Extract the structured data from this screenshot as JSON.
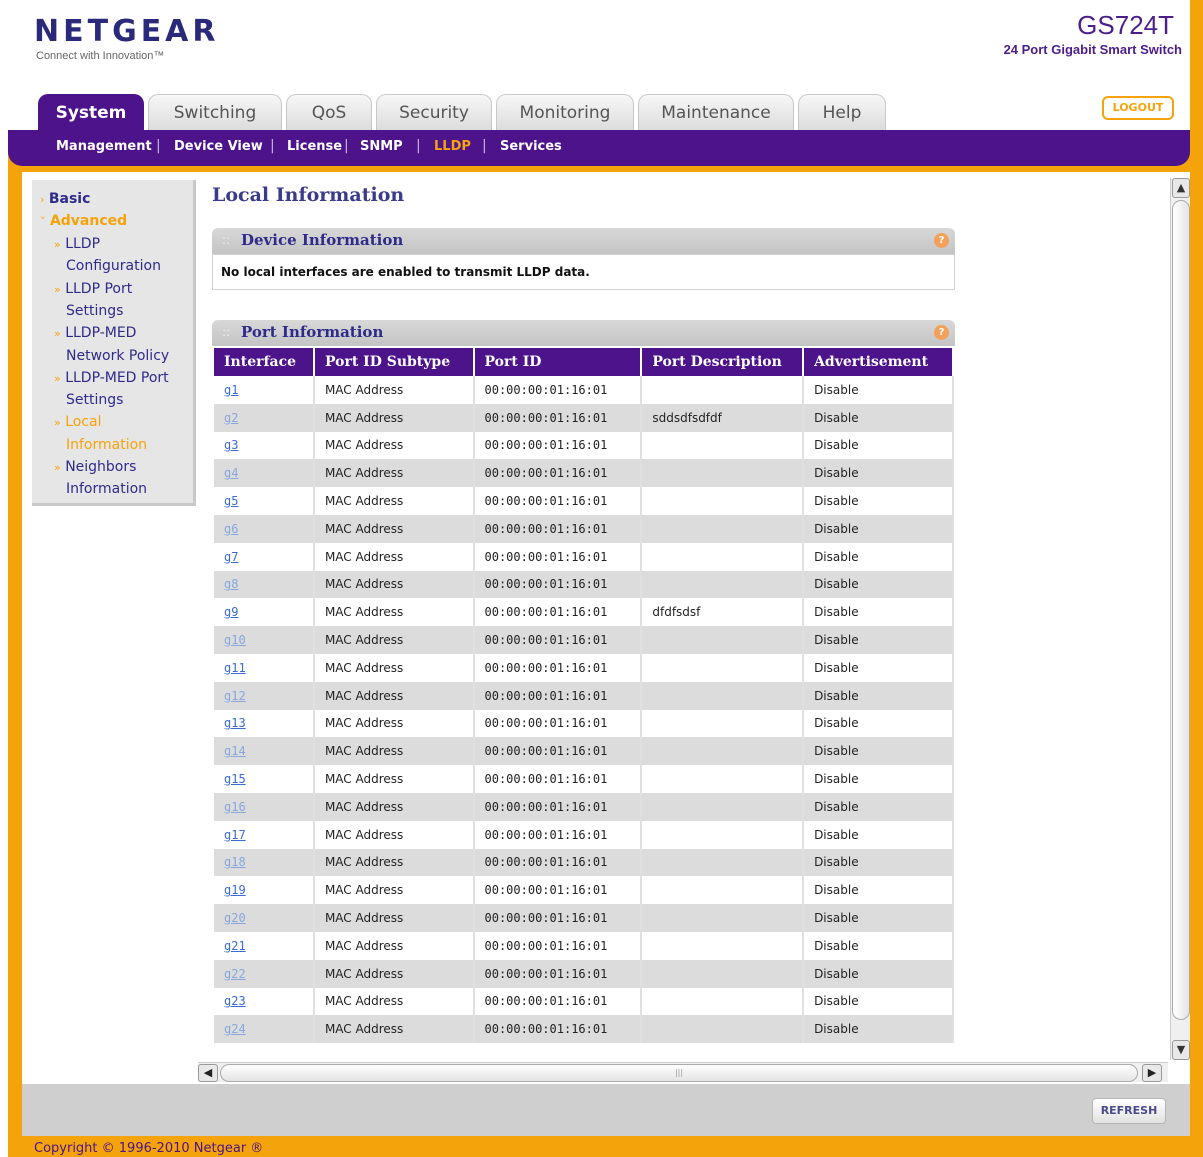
{
  "brand": {
    "logo": "NETGEAR",
    "tagline": "Connect with Innovation™",
    "model": "GS724T",
    "model_desc": "24 Port Gigabit Smart Switch"
  },
  "tabs": [
    "System",
    "Switching",
    "QoS",
    "Security",
    "Monitoring",
    "Maintenance",
    "Help"
  ],
  "logout": "LOGOUT",
  "subnav": [
    "Management",
    "Device View",
    "License",
    "SNMP",
    "LLDP",
    "Services"
  ],
  "sidebar": [
    {
      "bullet": "›",
      "label": "Basic"
    },
    {
      "bullet": "˅",
      "label": "Advanced"
    },
    {
      "bullet": "»",
      "label": "LLDP"
    },
    {
      "bullet": "",
      "label": "Configuration"
    },
    {
      "bullet": "»",
      "label": "LLDP Port"
    },
    {
      "bullet": "",
      "label": "Settings"
    },
    {
      "bullet": "»",
      "label": "LLDP-MED"
    },
    {
      "bullet": "",
      "label": "Network Policy"
    },
    {
      "bullet": "»",
      "label": "LLDP-MED Port"
    },
    {
      "bullet": "",
      "label": "Settings"
    },
    {
      "bullet": "»",
      "label": "Local"
    },
    {
      "bullet": "",
      "label": "Information"
    },
    {
      "bullet": "»",
      "label": "Neighbors"
    },
    {
      "bullet": "",
      "label": "Information"
    }
  ],
  "page_title": "Local Information",
  "device_section": {
    "title": "Device Information",
    "message": "No local interfaces are enabled to transmit LLDP data."
  },
  "port_section": {
    "title": "Port Information",
    "columns": [
      "Interface",
      "Port ID Subtype",
      "Port ID",
      "Port Description",
      "Advertisement"
    ],
    "rows": [
      [
        "g1",
        "MAC Address",
        "00:00:00:01:16:01",
        "",
        "Disable"
      ],
      [
        "g2",
        "MAC Address",
        "00:00:00:01:16:01",
        "sddsdfsdfdf",
        "Disable"
      ],
      [
        "g3",
        "MAC Address",
        "00:00:00:01:16:01",
        "",
        "Disable"
      ],
      [
        "g4",
        "MAC Address",
        "00:00:00:01:16:01",
        "",
        "Disable"
      ],
      [
        "g5",
        "MAC Address",
        "00:00:00:01:16:01",
        "",
        "Disable"
      ],
      [
        "g6",
        "MAC Address",
        "00:00:00:01:16:01",
        "",
        "Disable"
      ],
      [
        "g7",
        "MAC Address",
        "00:00:00:01:16:01",
        "",
        "Disable"
      ],
      [
        "g8",
        "MAC Address",
        "00:00:00:01:16:01",
        "",
        "Disable"
      ],
      [
        "g9",
        "MAC Address",
        "00:00:00:01:16:01",
        "dfdfsdsf",
        "Disable"
      ],
      [
        "g10",
        "MAC Address",
        "00:00:00:01:16:01",
        "",
        "Disable"
      ],
      [
        "g11",
        "MAC Address",
        "00:00:00:01:16:01",
        "",
        "Disable"
      ],
      [
        "g12",
        "MAC Address",
        "00:00:00:01:16:01",
        "",
        "Disable"
      ],
      [
        "g13",
        "MAC Address",
        "00:00:00:01:16:01",
        "",
        "Disable"
      ],
      [
        "g14",
        "MAC Address",
        "00:00:00:01:16:01",
        "",
        "Disable"
      ],
      [
        "g15",
        "MAC Address",
        "00:00:00:01:16:01",
        "",
        "Disable"
      ],
      [
        "g16",
        "MAC Address",
        "00:00:00:01:16:01",
        "",
        "Disable"
      ],
      [
        "g17",
        "MAC Address",
        "00:00:00:01:16:01",
        "",
        "Disable"
      ],
      [
        "g18",
        "MAC Address",
        "00:00:00:01:16:01",
        "",
        "Disable"
      ],
      [
        "g19",
        "MAC Address",
        "00:00:00:01:16:01",
        "",
        "Disable"
      ],
      [
        "g20",
        "MAC Address",
        "00:00:00:01:16:01",
        "",
        "Disable"
      ],
      [
        "g21",
        "MAC Address",
        "00:00:00:01:16:01",
        "",
        "Disable"
      ],
      [
        "g22",
        "MAC Address",
        "00:00:00:01:16:01",
        "",
        "Disable"
      ],
      [
        "g23",
        "MAC Address",
        "00:00:00:01:16:01",
        "",
        "Disable"
      ],
      [
        "g24",
        "MAC Address",
        "00:00:00:01:16:01",
        "",
        "Disable"
      ]
    ]
  },
  "refresh": "REFRESH",
  "copyright": "Copyright © 1996-2010 Netgear ®",
  "colors": {
    "accent": "#f5a30a",
    "brand_purple": "#4c138b"
  }
}
